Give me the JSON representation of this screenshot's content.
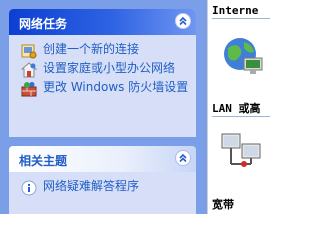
{
  "tasks_panel": {
    "title": "网络任务",
    "items": [
      {
        "label": "创建一个新的连接",
        "icon": "new-connection-icon"
      },
      {
        "label": "设置家庭或小型办公网络",
        "icon": "home-network-icon"
      },
      {
        "label": "更改 Windows 防火墙设置",
        "icon": "firewall-icon"
      }
    ]
  },
  "related_panel": {
    "title": "相关主题",
    "items": [
      {
        "label": "网络疑难解答程序",
        "icon": "info-icon"
      }
    ]
  },
  "content": {
    "category_internet": "Interne",
    "category_lan": "LAN 或高",
    "category_broadband": "宽带"
  },
  "colors": {
    "taskpane_bg": "#7b9ee8",
    "section_bg": "#d6dff7",
    "link": "#215dc6"
  }
}
